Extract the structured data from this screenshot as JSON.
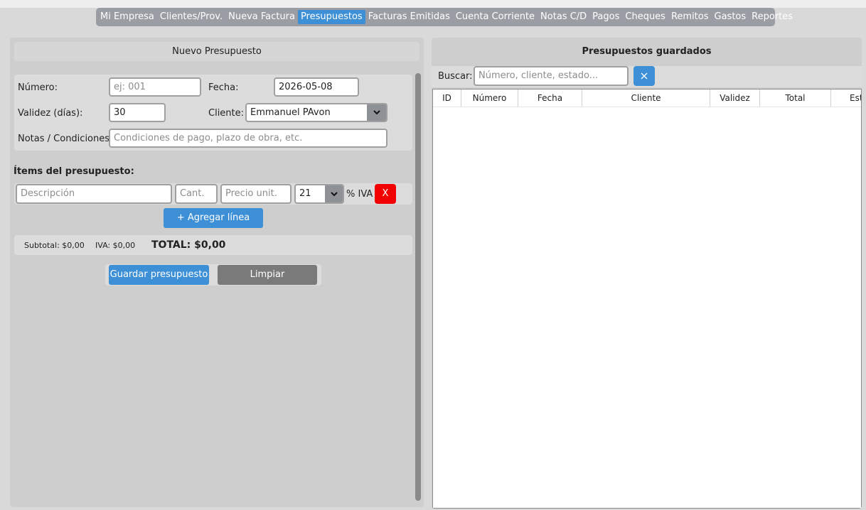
{
  "nav": {
    "tabs": [
      {
        "label": "Mi Empresa"
      },
      {
        "label": "Clientes/Prov."
      },
      {
        "label": "Nueva Factura"
      },
      {
        "label": "Presupuestos"
      },
      {
        "label": "Facturas Emitidas"
      },
      {
        "label": "Cuenta Corriente"
      },
      {
        "label": "Notas C/D"
      },
      {
        "label": "Pagos"
      },
      {
        "label": "Cheques"
      },
      {
        "label": "Remitos"
      },
      {
        "label": "Gastos"
      },
      {
        "label": "Reportes"
      }
    ],
    "active": "Presupuestos"
  },
  "form": {
    "title": "Nuevo Presupuesto",
    "numero_label": "Número:",
    "numero_placeholder": "ej: 001",
    "fecha_label": "Fecha:",
    "fecha_value": "2026-05-08",
    "validez_label": "Validez (días):",
    "validez_value": "30",
    "cliente_label": "Cliente:",
    "cliente_value": "Emmanuel PAvon",
    "notas_label": "Notas / Condiciones:",
    "notas_placeholder": "Condiciones de pago, plazo de obra, etc."
  },
  "items": {
    "title": "Ítems del presupuesto:",
    "descripcion_placeholder": "Descripción",
    "cant_placeholder": "Cant.",
    "precio_placeholder": "Precio unit.",
    "iva_value": "21",
    "iva_label": "% IVA",
    "remove_label": "X",
    "add_label": "+ Agregar línea"
  },
  "totals": {
    "subtotal": "Subtotal: $0,00",
    "iva": "IVA: $0,00",
    "total": "TOTAL: $0,00"
  },
  "actions": {
    "save_label": "Guardar presupuesto",
    "clear_label": "Limpiar"
  },
  "saved": {
    "title": "Presupuestos guardados",
    "search_label": "Buscar:",
    "search_placeholder": "Número, cliente, estado...",
    "columns": [
      "ID",
      "Número",
      "Fecha",
      "Cliente",
      "Validez",
      "Total",
      "Est"
    ]
  },
  "colors": {
    "accent": "#3d8fd6",
    "danger": "#f20000",
    "neutral_button": "#7a7a7a"
  }
}
